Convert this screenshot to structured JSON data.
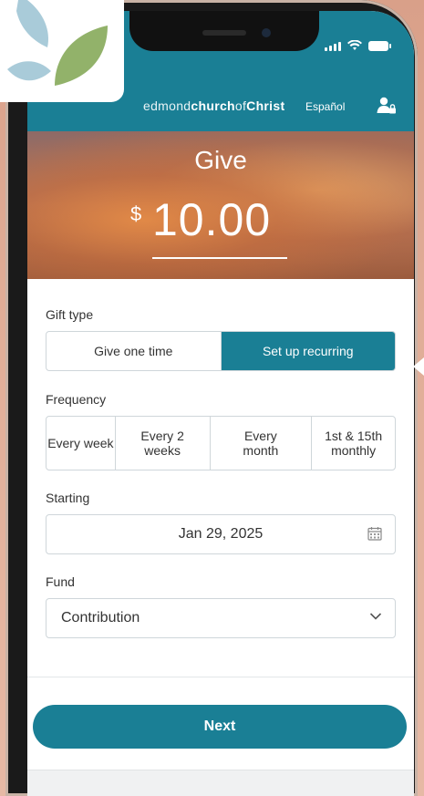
{
  "brand": {
    "prefix": "edmond",
    "middle": "church",
    "of": "of",
    "suffix": "Christ",
    "language_link": "Español"
  },
  "give": {
    "title": "Give",
    "currency": "$",
    "amount": "10.00"
  },
  "gift_type": {
    "label": "Gift type",
    "options": [
      "Give one time",
      "Set up recurring"
    ],
    "selected": "Set up recurring"
  },
  "frequency": {
    "label": "Frequency",
    "options": [
      "Every week",
      "Every 2 weeks",
      "Every month",
      "1st & 15th monthly"
    ]
  },
  "starting": {
    "label": "Starting",
    "date": "Jan 29, 2025"
  },
  "fund": {
    "label": "Fund",
    "selected": "Contribution"
  },
  "actions": {
    "next_label": "Next"
  },
  "colors": {
    "accent": "#1a7f95",
    "logo_blue": "#a9cbd9",
    "logo_green": "#92b26a"
  },
  "icons": [
    "signal-icon",
    "wifi-icon",
    "battery-icon",
    "user-lock-icon",
    "calendar-icon",
    "chevron-down-icon",
    "leaf-logo-icon"
  ]
}
